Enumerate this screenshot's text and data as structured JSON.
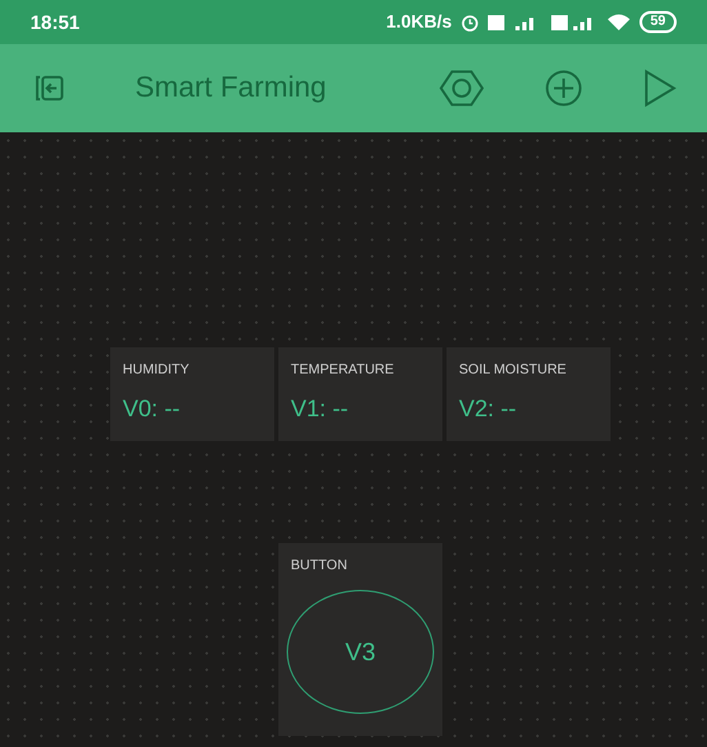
{
  "status_bar": {
    "time": "18:51",
    "speed": "1.0KB/s",
    "battery": "59"
  },
  "header": {
    "title": "Smart Farming"
  },
  "widgets": [
    {
      "label": "HUMIDITY",
      "value": "V0: --"
    },
    {
      "label": "TEMPERATURE",
      "value": "V1: --"
    },
    {
      "label": "SOIL MOISTURE",
      "value": "V2: --"
    }
  ],
  "button_widget": {
    "label": "BUTTON",
    "pin": "V3"
  }
}
